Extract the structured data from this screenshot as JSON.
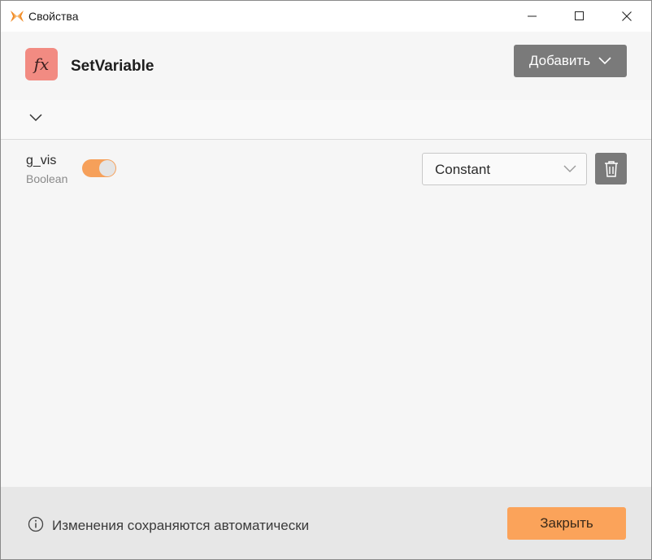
{
  "window": {
    "title": "Свойства"
  },
  "header": {
    "icon_label": "fx",
    "node_title": "SetVariable",
    "add_button_label": "Добавить"
  },
  "variable": {
    "name": "g_vis",
    "type": "Boolean",
    "toggle_on": true,
    "mode_value": "Constant"
  },
  "footer": {
    "info_text": "Изменения сохраняются автоматически",
    "close_button_label": "Закрыть"
  },
  "colors": {
    "fx_tile": "#f28b82",
    "accent_orange": "#fba35a",
    "toggle_track": "#f6a05a",
    "gray_button": "#7a7a7a"
  }
}
